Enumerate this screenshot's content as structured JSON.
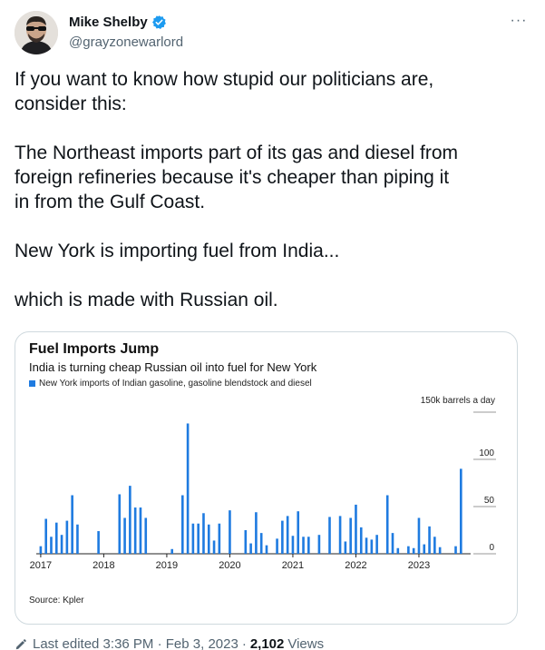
{
  "tweet": {
    "display_name": "Mike Shelby",
    "handle": "@grayzonewarlord",
    "more_label": "···",
    "text": "If you want to know how stupid our politicians are,\nconsider this:\n\nThe Northeast imports part of its gas and diesel from\nforeign refineries because it's cheaper than piping it\nin from the Gulf Coast.\n\nNew York is importing fuel from India...\n\nwhich is made with Russian oil."
  },
  "footer": {
    "edited": "Last edited 3:36 PM · Feb 3, 2023",
    "views_count": "2,102",
    "views_label": "Views"
  },
  "colors": {
    "bar": "#1f7be0",
    "accent_verified": "#1d9bf0"
  },
  "chart_data": {
    "type": "bar",
    "title": "Fuel Imports Jump",
    "subtitle": "India is turning cheap Russian oil into fuel for New York",
    "legend": "New York imports of Indian gasoline, gasoline blendstock and diesel",
    "unit_label": "150k barrels a day",
    "source": "Source: Kpler",
    "ylim": [
      0,
      150
    ],
    "yticks": [
      0,
      50,
      100,
      150
    ],
    "ytick_labels": [
      "0",
      "50",
      "100",
      ""
    ],
    "x_tick_labels": [
      "2017",
      "2018",
      "2019",
      "2020",
      "2021",
      "2022",
      "2023"
    ],
    "values": [
      8,
      37,
      18,
      33,
      20,
      35,
      62,
      31,
      0,
      0,
      0,
      24,
      0,
      0,
      0,
      63,
      38,
      72,
      49,
      49,
      38,
      0,
      0,
      0,
      0,
      5,
      0,
      62,
      138,
      32,
      32,
      43,
      31,
      14,
      32,
      0,
      46,
      0,
      0,
      25,
      11,
      44,
      22,
      9,
      0,
      16,
      35,
      40,
      19,
      45,
      18,
      18,
      0,
      20,
      0,
      39,
      0,
      40,
      13,
      38,
      52,
      28,
      17,
      15,
      20,
      0,
      62,
      22,
      6,
      0,
      8,
      6,
      38,
      10,
      29,
      18,
      7,
      0,
      0,
      8,
      90,
      0
    ]
  }
}
